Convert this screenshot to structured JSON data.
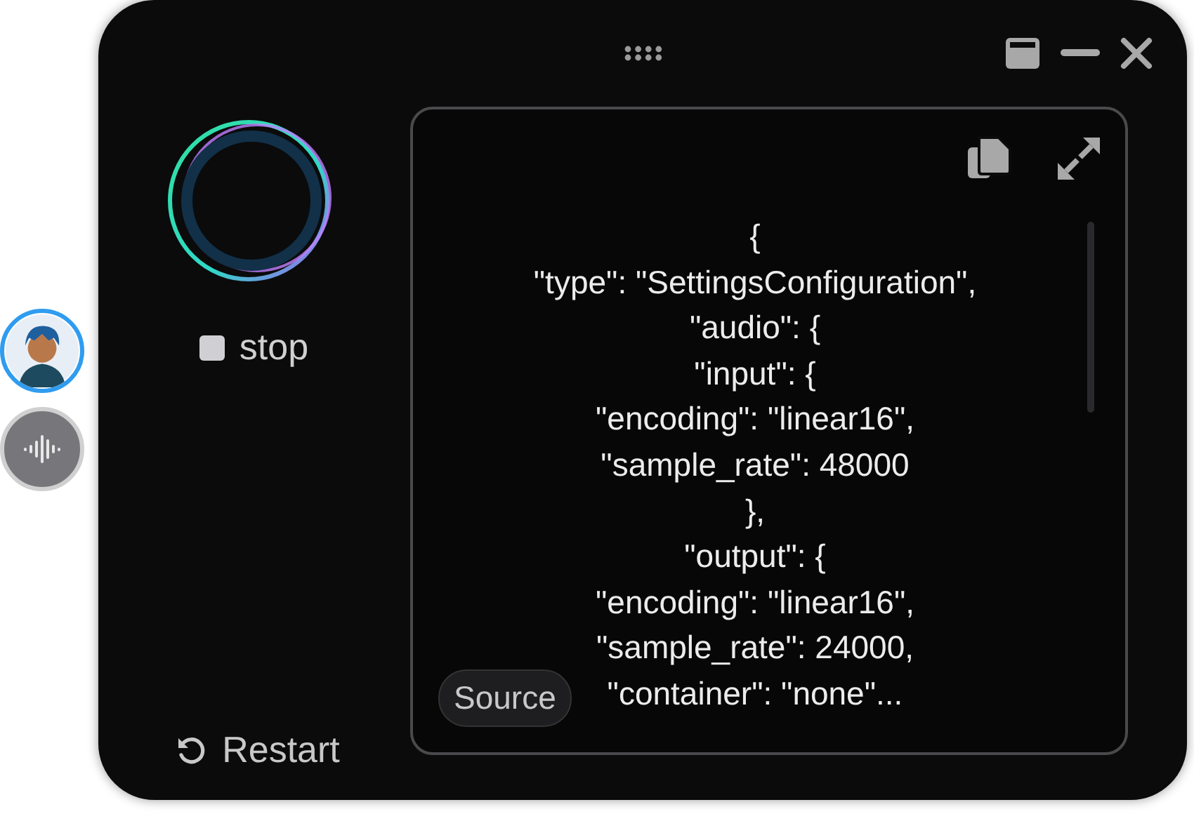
{
  "side_buttons": [
    {
      "kind": "avatar",
      "selected": true
    },
    {
      "kind": "waveform",
      "selected": false
    }
  ],
  "controls": {
    "stop_label": "stop",
    "restart_label": "Restart"
  },
  "code_panel": {
    "lines": [
      "{",
      "\"type\": \"SettingsConfiguration\",",
      "\"audio\": {",
      "\"input\": {",
      "\"encoding\": \"linear16\",",
      "\"sample_rate\": 48000",
      "},",
      "\"output\": {",
      "\"encoding\": \"linear16\",",
      "\"sample_rate\": 24000,",
      "\"container\": \"none\"..."
    ],
    "source_button": "Source"
  }
}
